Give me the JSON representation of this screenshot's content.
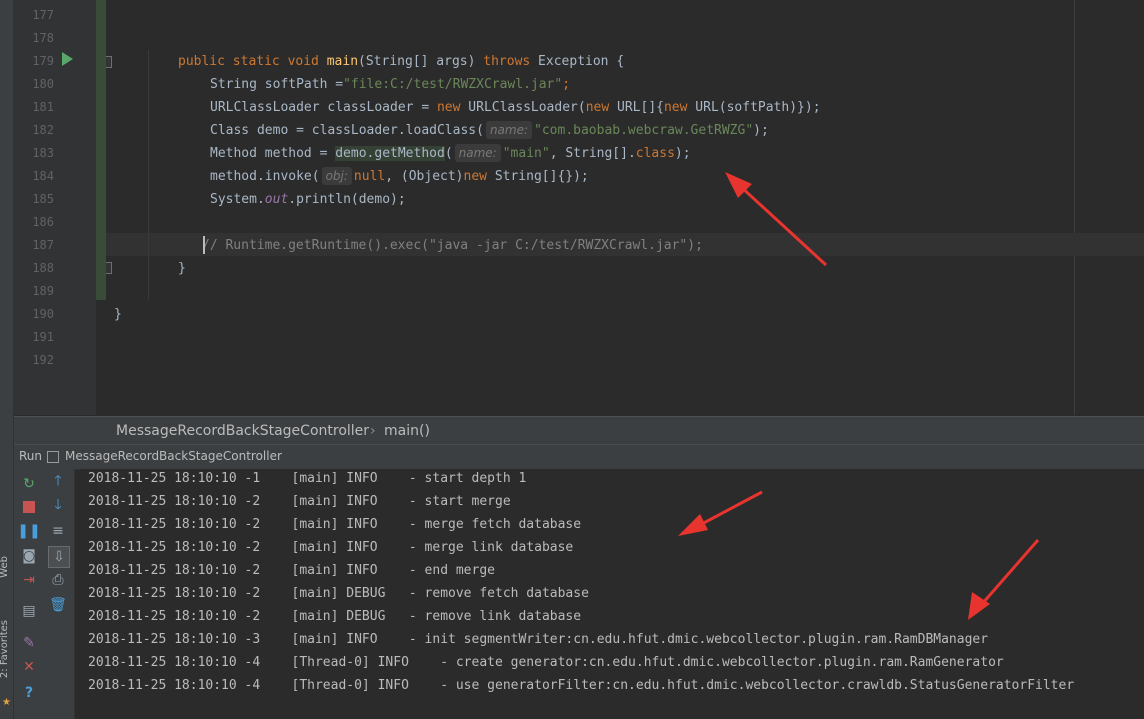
{
  "editor": {
    "line_numbers": [
      "177",
      "178",
      "179",
      "180",
      "181",
      "182",
      "183",
      "184",
      "185",
      "186",
      "187",
      "188",
      "189",
      "190",
      "191",
      "192"
    ],
    "code": {
      "l179": {
        "a": "public static void ",
        "b": "main",
        "c": "(String[] args) ",
        "d": "throws",
        " e": "",
        "e2": " Exception {"
      },
      "l180": {
        "a": "String softPath =",
        "b": "\"file:C:/test/RWZXCrawl.jar\"",
        "c": ";"
      },
      "l181": {
        "a": "URLClassLoader classLoader = ",
        "b": "new",
        " c": "",
        "c2": " URLClassLoader(",
        "d": "new",
        " e": "",
        "e2": " URL[]{",
        "f": "new",
        "g": " URL(softPath)});"
      },
      "l182": {
        "a": "Class demo = classLoader.loadClass(",
        "hint": "name:",
        "b": "\"com.baobab.webcraw.GetRWZG\"",
        "c": ");"
      },
      "l183": {
        "a": "Method method = ",
        "b": "demo.getMethod",
        "c": "(",
        "hint": "name:",
        "d": "\"main\"",
        "e": ", String[].",
        "f": "class",
        "g": ");"
      },
      "l184": {
        "a": "method.invoke(",
        "hint": "obj:",
        "b": "null",
        "c": ", (Object)",
        "d": "new",
        "e": " String[]{});"
      },
      "l185": {
        "a": "System.",
        "b": "out",
        "c": ".println(demo);"
      },
      "l187": {
        "a": "// ",
        "b": "Runtime.getRuntime().exec(\"java -jar C:/test/RWZXCrawl.jar\");"
      },
      "l188": {
        "a": "}"
      },
      "l190": {
        "a": "}"
      }
    }
  },
  "breadcrumb": {
    "class_name": "MessageRecordBackStageController",
    "separator": "›",
    "method": "main()"
  },
  "run": {
    "label": "Run",
    "config": "MessageRecordBackStageController"
  },
  "console": {
    "lines": [
      "2018-11-25 18:10:10 -1    [main] INFO    - start depth 1",
      "2018-11-25 18:10:10 -2    [main] INFO    - start merge",
      "2018-11-25 18:10:10 -2    [main] INFO    - merge fetch database",
      "2018-11-25 18:10:10 -2    [main] INFO    - merge link database",
      "2018-11-25 18:10:10 -2    [main] INFO    - end merge",
      "2018-11-25 18:10:10 -2    [main] DEBUG   - remove fetch database",
      "2018-11-25 18:10:10 -2    [main] DEBUG   - remove link database",
      "2018-11-25 18:10:10 -3    [main] INFO    - init segmentWriter:cn.edu.hfut.dmic.webcollector.plugin.ram.RamDBManager",
      "2018-11-25 18:10:10 -4    [Thread-0] INFO    - create generator:cn.edu.hfut.dmic.webcollector.plugin.ram.RamGenerator",
      "2018-11-25 18:10:10 -4    [Thread-0] INFO    - use generatorFilter:cn.edu.hfut.dmic.webcollector.crawldb.StatusGeneratorFilter"
    ]
  },
  "side_tabs": {
    "web": "Web",
    "favorites": "2: Favorites"
  },
  "icons": {
    "rerun": "rerun-icon",
    "stop": "stop-icon",
    "pause": "pause-icon",
    "camera": "dump-threads-icon",
    "exit": "exit-icon",
    "layout": "layout-icon",
    "pin": "pin-icon",
    "close": "close-icon",
    "help": "help-icon",
    "up": "up-arrow-icon",
    "down": "down-arrow-icon",
    "wrap": "soft-wrap-icon",
    "scroll": "scroll-to-end-icon",
    "print": "print-icon",
    "trash": "clear-all-icon"
  },
  "colors": {
    "accent_green": "#59a869",
    "stop_red": "#c75450",
    "arrow_red": "#e8342f"
  }
}
